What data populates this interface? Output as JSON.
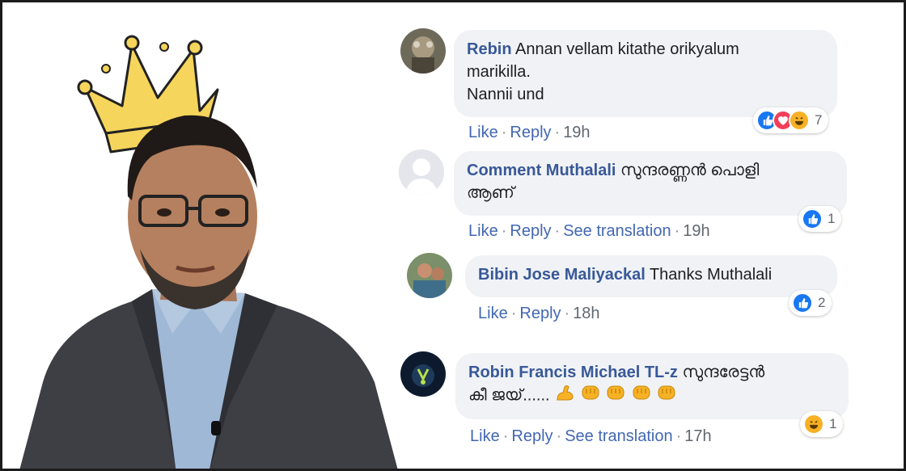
{
  "comments": [
    {
      "author": "Rebin",
      "text_lines": [
        "Annan vellam kitathe orikyalum",
        "marikilla.",
        "Nannii und"
      ],
      "actions": [
        "Like",
        "Reply"
      ],
      "time": "19h",
      "reactions": [
        "like-icon",
        "love-icon",
        "haha-icon"
      ],
      "reaction_count": "7"
    },
    {
      "author": "Comment Muthalali",
      "text_lines": [
        "സുന്ദരണ്ണൻ പൊളി",
        "ആണ്"
      ],
      "actions": [
        "Like",
        "Reply",
        "See translation"
      ],
      "time": "19h",
      "reactions": [
        "like-icon"
      ],
      "reaction_count": "1"
    },
    {
      "author": "Bibin Jose Maliyackal",
      "text_lines": [
        "Thanks Muthalali"
      ],
      "actions": [
        "Like",
        "Reply"
      ],
      "time": "18h",
      "reactions": [
        "like-icon"
      ],
      "reaction_count": "2"
    },
    {
      "author": "Robin Francis Michael TL-z",
      "text_lines": [
        "സുന്ദരേട്ടൻ",
        "കീ ജയ്......"
      ],
      "emojis": [
        "flexed-biceps-icon",
        "fist-icon",
        "fist-icon",
        "fist-icon",
        "fist-icon"
      ],
      "actions": [
        "Like",
        "Reply",
        "See translation"
      ],
      "time": "17h",
      "reactions": [
        "haha-icon"
      ],
      "reaction_count": "1"
    }
  ],
  "colors": {
    "author": "#385898",
    "link": "#4267b2",
    "bubble": "#f0f2f5",
    "like": "#1877f2",
    "love": "#f33e58",
    "haha": "#f7b125",
    "crown": "#f6d55c"
  }
}
